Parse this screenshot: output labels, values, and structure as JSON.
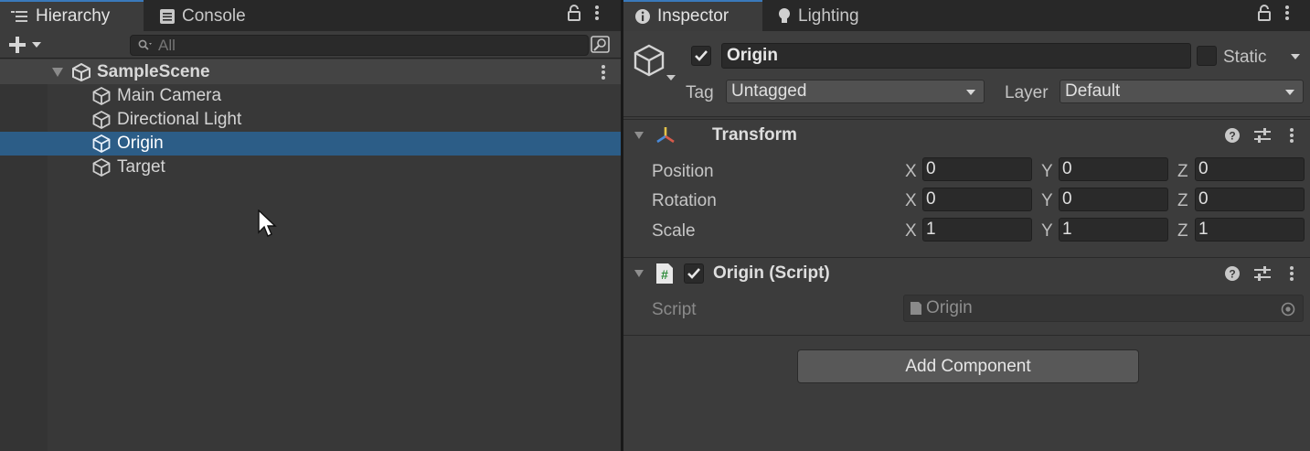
{
  "hierarchy": {
    "tabs": [
      {
        "label": "Hierarchy",
        "icon": "list-icon",
        "active": true
      },
      {
        "label": "Console",
        "icon": "console-icon",
        "active": false
      }
    ],
    "search_placeholder": "All",
    "scene": {
      "name": "SampleScene"
    },
    "items": [
      {
        "label": "Main Camera",
        "selected": false
      },
      {
        "label": "Directional Light",
        "selected": false
      },
      {
        "label": "Origin",
        "selected": true
      },
      {
        "label": "Target",
        "selected": false
      }
    ]
  },
  "inspector": {
    "tabs": [
      {
        "label": "Inspector",
        "icon": "info-icon",
        "active": true
      },
      {
        "label": "Lighting",
        "icon": "lightbulb-icon",
        "active": false
      }
    ],
    "object": {
      "active": true,
      "name": "Origin",
      "static_label": "Static",
      "static": false,
      "tag_label": "Tag",
      "tag_value": "Untagged",
      "layer_label": "Layer",
      "layer_value": "Default"
    },
    "transform": {
      "title": "Transform",
      "rows": [
        {
          "label": "Position",
          "x": "0",
          "y": "0",
          "z": "0"
        },
        {
          "label": "Rotation",
          "x": "0",
          "y": "0",
          "z": "0"
        },
        {
          "label": "Scale",
          "x": "1",
          "y": "1",
          "z": "1"
        }
      ],
      "axis_labels": {
        "x": "X",
        "y": "Y",
        "z": "Z"
      }
    },
    "script_component": {
      "title": "Origin (Script)",
      "enabled": true,
      "field_label": "Script",
      "field_value": "Origin"
    },
    "add_component_label": "Add Component"
  },
  "colors": {
    "selection": "#2c5d87",
    "active_tab_accent": "#3a79bb",
    "panel_bg": "#383838"
  }
}
